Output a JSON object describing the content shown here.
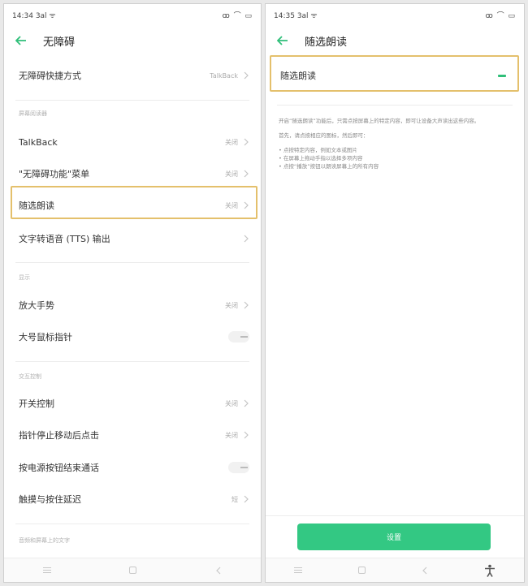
{
  "left": {
    "status": {
      "time": "14:34",
      "signal": "3al ᯤ",
      "right": "ꝏ ⌒ ▭"
    },
    "title": "无障碍",
    "rows": [
      {
        "label": "无障碍快捷方式",
        "value": "TalkBack"
      },
      {
        "label": "TalkBack",
        "value": "关闭"
      },
      {
        "label": "\"无障碍功能\"菜单",
        "value": "关闭"
      },
      {
        "label": "随选朗读",
        "value": "关闭"
      },
      {
        "label": "文字转语音 (TTS) 输出",
        "value": ""
      },
      {
        "label": "放大手势",
        "value": "关闭"
      },
      {
        "label": "大号鼠标指针",
        "value": ""
      },
      {
        "label": "开关控制",
        "value": "关闭"
      },
      {
        "label": "指针停止移动后点击",
        "value": "关闭"
      },
      {
        "label": "按电源按钮结束通话",
        "value": ""
      },
      {
        "label": "触摸与按住延迟",
        "value": "短"
      }
    ],
    "sections": [
      "屏幕阅读器",
      "显示",
      "交互控制",
      "音频和屏幕上的文字"
    ]
  },
  "right": {
    "status": {
      "time": "14:35",
      "signal": "3al ᯤ",
      "right": "ꝏ ⌒ ▭"
    },
    "title": "随选朗读",
    "toggle_label": "随选朗读",
    "desc": [
      "开启“随选朗读”功能后，只需点按屏幕上的特定内容，即可让设备大声读出这些内容。",
      "首先，请点按相应的图标，然后即可：",
      "• 点按特定内容，例如文本或图片",
      "• 在屏幕上拖动手指以选择多项内容",
      "• 点按“播放”按钮以朗读屏幕上的所有内容"
    ],
    "button": "设置"
  },
  "colors": {
    "accent": "#2fbf79",
    "highlight": "#e4c06c"
  }
}
